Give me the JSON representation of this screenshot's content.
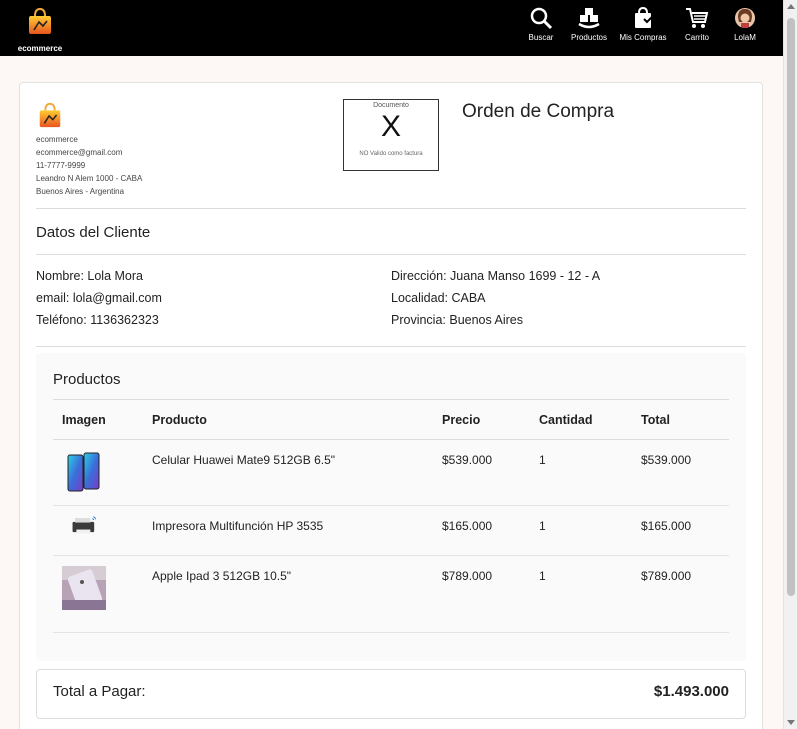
{
  "nav": {
    "brand_label": "ecommerce",
    "items": [
      {
        "label": "Buscar",
        "icon": "search-icon"
      },
      {
        "label": "Productos",
        "icon": "products-icon"
      },
      {
        "label": "Mis Compras",
        "icon": "shopping-bag-icon"
      },
      {
        "label": "Carrito",
        "icon": "cart-icon"
      },
      {
        "label": "LolaM",
        "icon": "avatar"
      }
    ]
  },
  "company": {
    "name": "ecommerce",
    "email": "ecommerce@gmail.com",
    "phone": "11-7777-9999",
    "address": "Leandro N Alem 1000 - CABA",
    "city": "Buenos Aires - Argentina"
  },
  "document": {
    "label": "Documento",
    "letter": "X",
    "note": "NO Valido como factura"
  },
  "order_title": "Orden de Compra",
  "client": {
    "title": "Datos del Cliente",
    "name": "Nombre: Lola Mora",
    "email": "email: lola@gmail.com",
    "phone": "Teléfono: 1136362323",
    "address": "Dirección: Juana Manso 1699 - 12 - A",
    "locality": "Localidad: CABA",
    "province": "Provincia: Buenos Aires"
  },
  "products": {
    "title": "Productos",
    "headers": [
      "Imagen",
      "Producto",
      "Precio",
      "Cantidad",
      "Total"
    ],
    "rows": [
      {
        "name": "Celular Huawei Mate9 512GB 6.5\"",
        "price": "$539.000",
        "qty": "1",
        "total": "$539.000",
        "image": "phone-image"
      },
      {
        "name": "Impresora Multifunción HP 3535",
        "price": "$165.000",
        "qty": "1",
        "total": "$165.000",
        "image": "printer-image"
      },
      {
        "name": "Apple Ipad 3 512GB 10.5\"",
        "price": "$789.000",
        "qty": "1",
        "total": "$789.000",
        "image": "tablet-image"
      }
    ]
  },
  "total": {
    "label": "Total a Pagar:",
    "value": "$1.493.000"
  },
  "colors": {
    "navbar": "#000000",
    "page_bg": "#fdf7f6",
    "logo_orange": "#f39c12"
  }
}
